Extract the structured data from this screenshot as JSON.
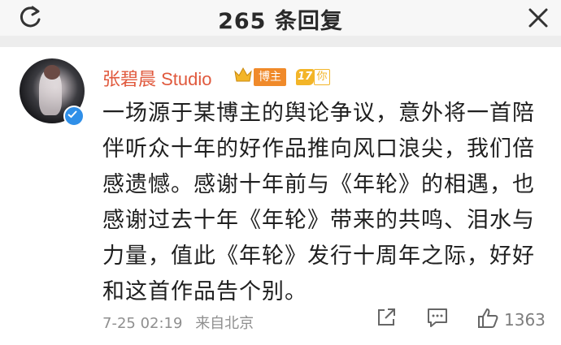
{
  "header": {
    "title": "265 条回复",
    "refresh_icon": "refresh-icon",
    "close_icon": "close-icon"
  },
  "post": {
    "username": "张碧晨 Studio",
    "badge_blogger": "博主",
    "badge_level": "17",
    "badge_level_suffix": "你",
    "text": "一场源于某博主的舆论争议，意外将一首陪伴听众十年的好作品推向风口浪尖，我们倍感遗憾。感谢十年前与《年轮》的相遇，也感谢过去十年《年轮》带来的共鸣、泪水与力量，值此《年轮》发行十周年之际，好好和这首作品告个别。",
    "date": "7-25 02:19",
    "source": "来自北京",
    "like_count": "1363"
  },
  "colors": {
    "username": "#e0593d",
    "verified": "#2f8fe8",
    "blogger_badge": "#f08a2a",
    "level_badge": "#f3b528",
    "meta": "#8f8f8f"
  }
}
